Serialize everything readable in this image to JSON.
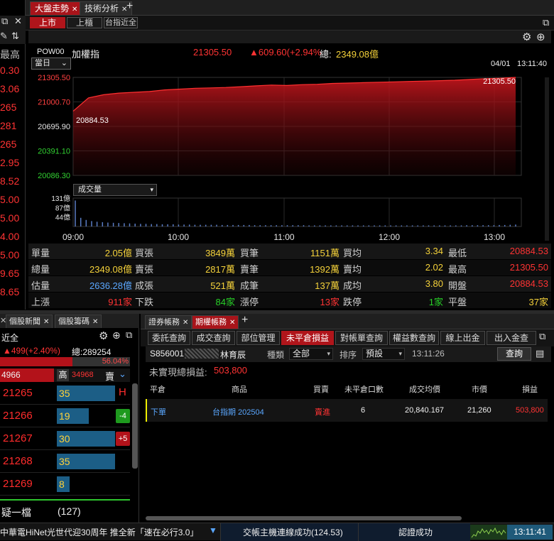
{
  "top_tabs": [
    {
      "label": "大盤走勢",
      "active": true
    },
    {
      "label": "技術分析",
      "active": false
    }
  ],
  "plus": "+",
  "market_buttons": [
    {
      "label": "上市",
      "active": true
    },
    {
      "label": "上櫃",
      "active": false
    },
    {
      "label": "台指近全",
      "active": false
    }
  ],
  "index": {
    "code": "POW00",
    "name": "加權指",
    "price": "21305.50",
    "change": "▲609.60(+2.94%",
    "total_label": "總:",
    "total": "2349.08億",
    "period": "當日",
    "date": "04/01",
    "time": "13:11:40"
  },
  "chart_data": {
    "type": "area",
    "y_ticks": [
      "21305.50",
      "21000.70",
      "20695.90",
      "20391.10",
      "20086.30"
    ],
    "x_ticks": [
      "09:00",
      "10:00",
      "11:00",
      "12:00",
      "13:00"
    ],
    "price_high_label": "21305.50",
    "price_low_label": "20884.53",
    "ylim": [
      20086.3,
      21305.5
    ],
    "series": [
      {
        "values": [
          20884.53,
          21050,
          21090,
          21110,
          21120,
          21130,
          21150,
          21160,
          21170,
          21175,
          21180,
          21190,
          21200,
          21210,
          21205,
          21215,
          21220,
          21230,
          21235,
          21240,
          21245,
          21250,
          21255,
          21260,
          21265,
          21270,
          21280,
          21290,
          21295,
          21305.5
        ]
      }
    ],
    "volume_label": "成交量",
    "volume_ticks": [
      "131億",
      "87億",
      "44億"
    ],
    "volume_ylim": [
      0,
      131
    ],
    "volume": [
      120,
      40,
      30,
      25,
      22,
      20,
      18,
      17,
      16,
      15,
      14,
      13,
      12,
      12,
      11,
      11,
      10,
      10,
      10,
      9,
      9,
      9,
      8,
      8,
      8,
      8,
      8,
      7,
      7,
      7,
      7,
      7,
      7,
      6,
      6,
      6,
      6,
      6,
      6,
      6,
      6,
      6,
      6,
      5,
      5,
      5,
      5,
      5,
      5,
      5,
      5,
      5,
      5,
      5,
      5,
      5,
      5,
      5,
      5,
      5,
      5,
      5,
      5,
      5,
      5,
      5,
      5,
      5,
      5,
      5,
      5,
      5,
      6,
      6,
      6,
      6,
      6,
      6,
      7,
      7,
      8,
      9
    ]
  },
  "stats": [
    [
      {
        "l": "單量",
        "v": "2.05億",
        "c": "yellow"
      },
      {
        "l": "買張",
        "v": "3849萬",
        "c": "yellow"
      },
      {
        "l": "買筆",
        "v": "1151萬",
        "c": "yellow"
      },
      {
        "l": "買均",
        "v": "3.34",
        "c": "yellow"
      },
      {
        "l": "最低",
        "v": "20884.53",
        "c": "red"
      }
    ],
    [
      {
        "l": "總量",
        "v": "2349.08億",
        "c": "yellow"
      },
      {
        "l": "賣張",
        "v": "2817萬",
        "c": "yellow"
      },
      {
        "l": "賣筆",
        "v": "1392萬",
        "c": "yellow"
      },
      {
        "l": "賣均",
        "v": "2.02",
        "c": "yellow"
      },
      {
        "l": "最高",
        "v": "21305.50",
        "c": "red"
      }
    ],
    [
      {
        "l": "估量",
        "v": "2636.28億",
        "c": "blue"
      },
      {
        "l": "成張",
        "v": "521萬",
        "c": "yellow"
      },
      {
        "l": "成筆",
        "v": "137萬",
        "c": "yellow"
      },
      {
        "l": "成均",
        "v": "3.80",
        "c": "yellow"
      },
      {
        "l": "開盤",
        "v": "20884.53",
        "c": "red"
      }
    ],
    [
      {
        "l": "上漲",
        "v": "911家",
        "c": "red"
      },
      {
        "l": "下跌",
        "v": "84家",
        "c": "green"
      },
      {
        "l": "漲停",
        "v": "13家",
        "c": "red"
      },
      {
        "l": "跌停",
        "v": "1家",
        "c": "green"
      },
      {
        "l": "平盤",
        "v": "37家",
        "c": "yellow"
      }
    ]
  ],
  "left_prices": [
    "0.30",
    "3.06",
    "265",
    "281",
    "265",
    "2.95",
    "8.52",
    "5.00",
    "5.00",
    "4.00",
    "5.00",
    "9.65",
    "8.65"
  ],
  "left_header": "最高",
  "left_bottom": {
    "tabs": [
      "個股新聞",
      "個股籌碼"
    ],
    "title": "近全",
    "change": "▲499(+2.40%)",
    "total": "總:289254",
    "pct": "56.04%",
    "bid": "4966",
    "high_label": "高",
    "high": "34968",
    "sell_label": "賣",
    "ladder": [
      {
        "p": "21265",
        "v": "35",
        "tag": "H",
        "tagc": "red-text"
      },
      {
        "p": "21266",
        "v": "19",
        "tag": "-4",
        "tagc": "green-box"
      },
      {
        "p": "21267",
        "v": "30",
        "tag": "+5",
        "tagc": "red-box"
      },
      {
        "p": "21268",
        "v": "35",
        "tag": "",
        "tagc": ""
      },
      {
        "p": "21269",
        "v": "8",
        "tag": "",
        "tagc": ""
      }
    ],
    "footer_label": "疑一檔",
    "footer_count": "(127)"
  },
  "order": {
    "top_tabs": [
      {
        "label": "證券帳務",
        "active": false
      },
      {
        "label": "期權帳務",
        "active": true
      }
    ],
    "sub_tabs": [
      {
        "label": "委託查詢",
        "active": false
      },
      {
        "label": "成交查詢",
        "active": false
      },
      {
        "label": "部位管理",
        "active": false
      },
      {
        "label": "未平倉損益",
        "active": true
      },
      {
        "label": "對帳單查詢",
        "active": false
      },
      {
        "label": "權益數查詢",
        "active": false
      },
      {
        "label": "線上出金",
        "active": false
      },
      {
        "label": "出入金查",
        "active": false
      }
    ],
    "account": "S856001",
    "account_name": "林育辰",
    "kind_label": "種類",
    "kind": "全部",
    "sort_label": "排序",
    "sort": "預設",
    "time": "13:11:26",
    "query": "查詢",
    "unrealized_label": "未實現總損益:",
    "unrealized": "503,800",
    "headers": [
      "平倉",
      "商品",
      "買賣",
      "未平倉口數",
      "成交均價",
      "市價",
      "損益"
    ],
    "row": {
      "close": "下單",
      "product": "台指期 202504",
      "side": "賣進",
      "qty": "6",
      "avg": "20,840.167",
      "mkt": "21,260",
      "pl": "503,800"
    }
  },
  "status": {
    "ticker": "中華電HiNet光世代迎30周年 推全新「速在必行3.0」",
    "conn": "交帳主機連線成功(124.53)",
    "auth": "認證成功",
    "clock": "13:11:41"
  }
}
